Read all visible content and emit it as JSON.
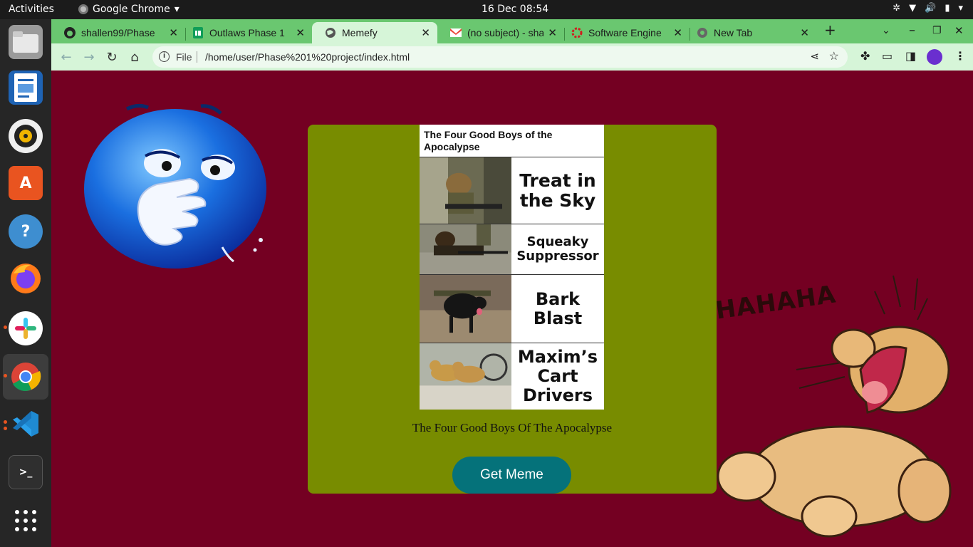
{
  "topbar": {
    "activities": "Activities",
    "app_name": "Google Chrome",
    "clock": "16 Dec  08:54"
  },
  "tabs": [
    {
      "label": "shallen99/Phase",
      "icon": "github-icon"
    },
    {
      "label": "Outlaws Phase 1",
      "icon": "sheets-icon"
    },
    {
      "label": "Memefy",
      "icon": "globe-icon"
    },
    {
      "label": "(no subject) - sha",
      "icon": "gmail-icon"
    },
    {
      "label": "Software Engine",
      "icon": "ring-icon"
    },
    {
      "label": "New Tab",
      "icon": "chrome-icon"
    }
  ],
  "omnibox": {
    "scheme": "File",
    "url": "/home/user/Phase%201%20project/index.html"
  },
  "meme": {
    "title": "The Four Good Boys of the Apocalypse",
    "panels": [
      "Treat in the Sky",
      "Squeaky Suppressor",
      "Bark Blast",
      "Maxim’s Cart Drivers"
    ]
  },
  "caption": "The Four Good Boys Of The Apocalypse",
  "button_label": "Get Meme",
  "hahaha": "HAHAHA",
  "colors": {
    "page_bg": "#740022",
    "card_bg": "#788c00",
    "button_bg": "#05727a",
    "tabstrip": "#6ac770"
  }
}
